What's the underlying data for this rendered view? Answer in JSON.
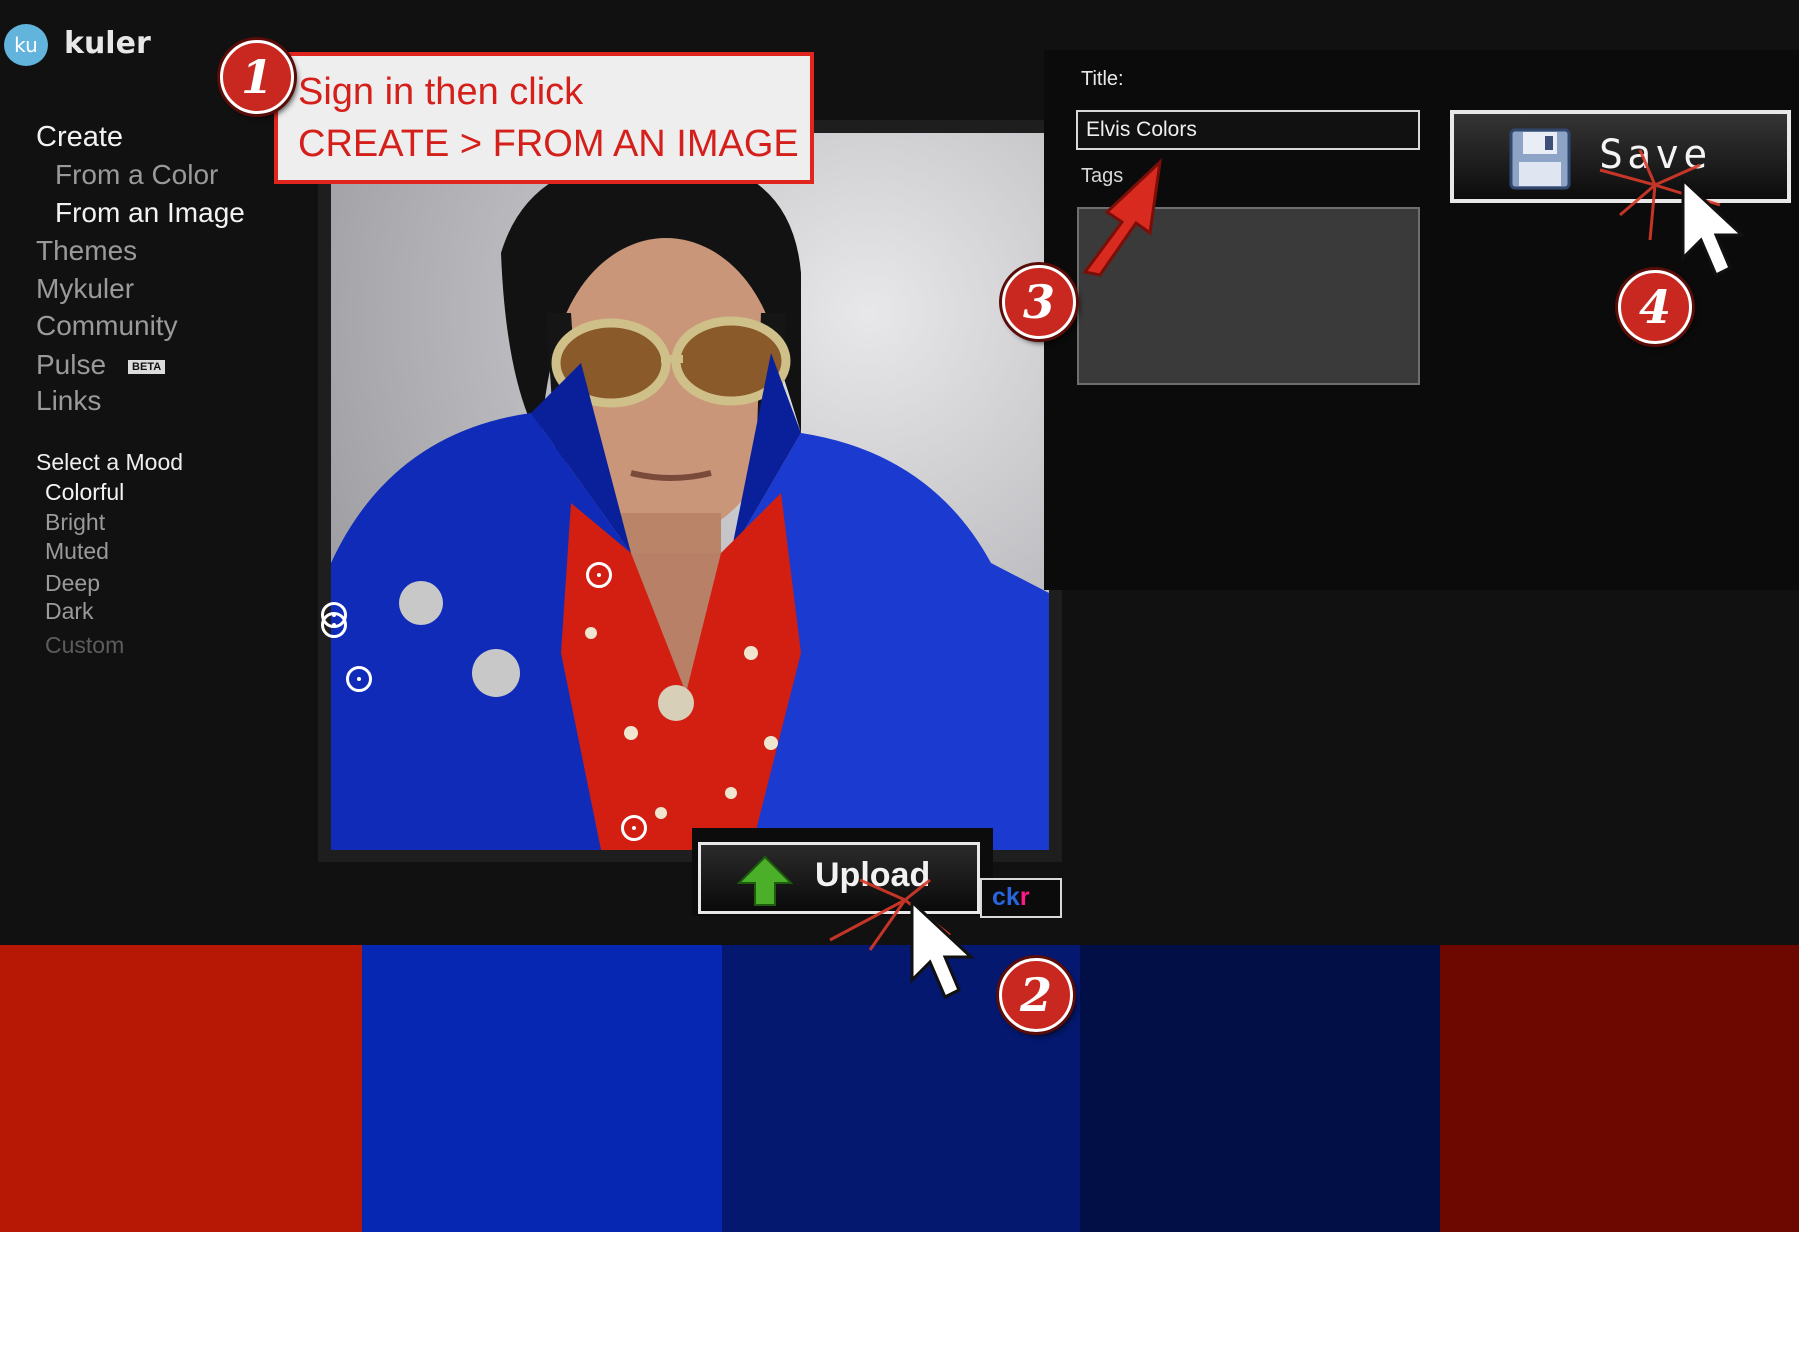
{
  "app": {
    "logo_badge": "ku",
    "logo_name": "kuler"
  },
  "sidebar": {
    "nav": [
      {
        "label": "Create",
        "state": "bright"
      },
      {
        "label": "From a Color",
        "state": "normal"
      },
      {
        "label": "From an Image",
        "state": "bright"
      },
      {
        "label": "Themes",
        "state": "normal"
      },
      {
        "label": "Mykuler",
        "state": "normal"
      },
      {
        "label": "Community",
        "state": "normal"
      },
      {
        "label": "Pulse",
        "state": "normal",
        "badge": "BETA"
      },
      {
        "label": "Links",
        "state": "normal"
      }
    ],
    "mood_heading": "Select a Mood",
    "moods": [
      {
        "label": "Colorful",
        "state": "active"
      },
      {
        "label": "Bright",
        "state": "normal"
      },
      {
        "label": "Muted",
        "state": "normal"
      },
      {
        "label": "Deep",
        "state": "normal"
      },
      {
        "label": "Dark",
        "state": "normal"
      },
      {
        "label": "Custom",
        "state": "disabled"
      }
    ]
  },
  "form": {
    "title_label": "Title:",
    "title_value": "Elvis Colors",
    "tags_label": "Tags",
    "tags_value": "",
    "save_label": "Save"
  },
  "image_actions": {
    "upload_label": "Upload",
    "flickr_label_a": "ck",
    "flickr_label_b": "r"
  },
  "swatches": {
    "colors": [
      "#b71805",
      "#0627b2",
      "#03186e",
      "#020f47",
      "#6c0800"
    ]
  },
  "annotations": {
    "callout_line1": "Sign in then click",
    "callout_line2": "CREATE > FROM AN IMAGE",
    "steps": [
      "1",
      "2",
      "3",
      "4"
    ]
  }
}
